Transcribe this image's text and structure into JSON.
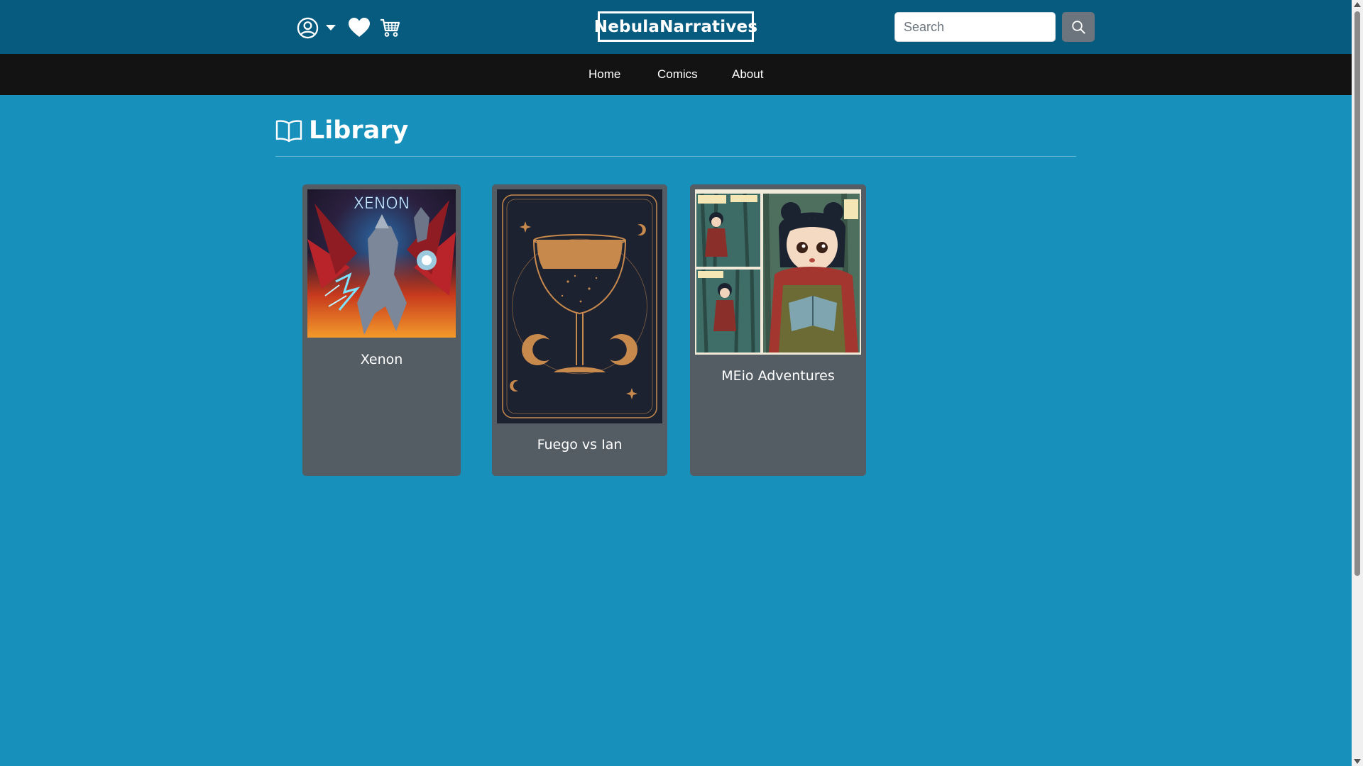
{
  "header": {
    "brand": "NebulaNarratives",
    "search_placeholder": "Search",
    "icons": [
      "user-circle-icon",
      "caret-down-icon",
      "heart-icon",
      "cart-icon",
      "search-icon"
    ]
  },
  "nav": {
    "items": [
      {
        "label": "Home"
      },
      {
        "label": "Comics"
      },
      {
        "label": "About"
      }
    ]
  },
  "library": {
    "icon": "book-open-icon",
    "title": "Library",
    "comics": [
      {
        "title": "Xenon",
        "cover_text": "XENON"
      },
      {
        "title": "Fuego vs Ian"
      },
      {
        "title": "MEio Adventures"
      }
    ]
  },
  "colors": {
    "header_bg": "#075b7e",
    "nav_bg": "#131313",
    "page_bg": "#1791bb",
    "card_bg": "#545c64",
    "search_button_bg": "#6c757d"
  }
}
